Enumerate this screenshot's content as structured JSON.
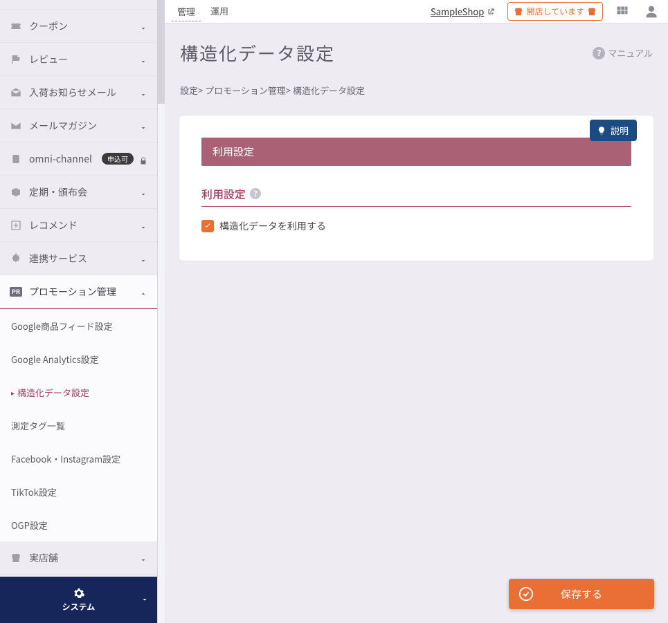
{
  "topbar": {
    "tabs": [
      "管理",
      "運用"
    ],
    "shop_name": "SampleShop",
    "open_button": "開店しています"
  },
  "sidebar": {
    "items": [
      {
        "label": "クーポン"
      },
      {
        "label": "レビュー"
      },
      {
        "label": "入荷お知らせメール"
      },
      {
        "label": "メールマガジン"
      },
      {
        "label": "omni-channel",
        "badge": "申込可",
        "locked": true
      },
      {
        "label": "定期・頒布会"
      },
      {
        "label": "レコメンド"
      },
      {
        "label": "連携サービス"
      },
      {
        "label": "プロモーション管理"
      },
      {
        "label": "実店舗"
      }
    ],
    "sub": [
      {
        "label": "Google商品フィード設定"
      },
      {
        "label": "Google Analytics設定"
      },
      {
        "label": "構造化データ設定"
      },
      {
        "label": "測定タグ一覧"
      },
      {
        "label": "Facebook・Instagram設定"
      },
      {
        "label": "TikTok設定"
      },
      {
        "label": "OGP設定"
      }
    ],
    "system": "システム"
  },
  "page": {
    "title": "構造化データ設定",
    "manual": "マニュアル"
  },
  "breadcrumb": {
    "parts": [
      "設定",
      "プロモーション管理",
      "構造化データ設定"
    ],
    "sep": "> "
  },
  "card": {
    "explain": "説明",
    "section_title": "利用設定",
    "section_sub": "利用設定",
    "checkbox_label": "構造化データを利用する",
    "checkbox_checked": true
  },
  "footer": {
    "save": "保存する"
  },
  "ui_text": {
    "pr": "PR"
  }
}
